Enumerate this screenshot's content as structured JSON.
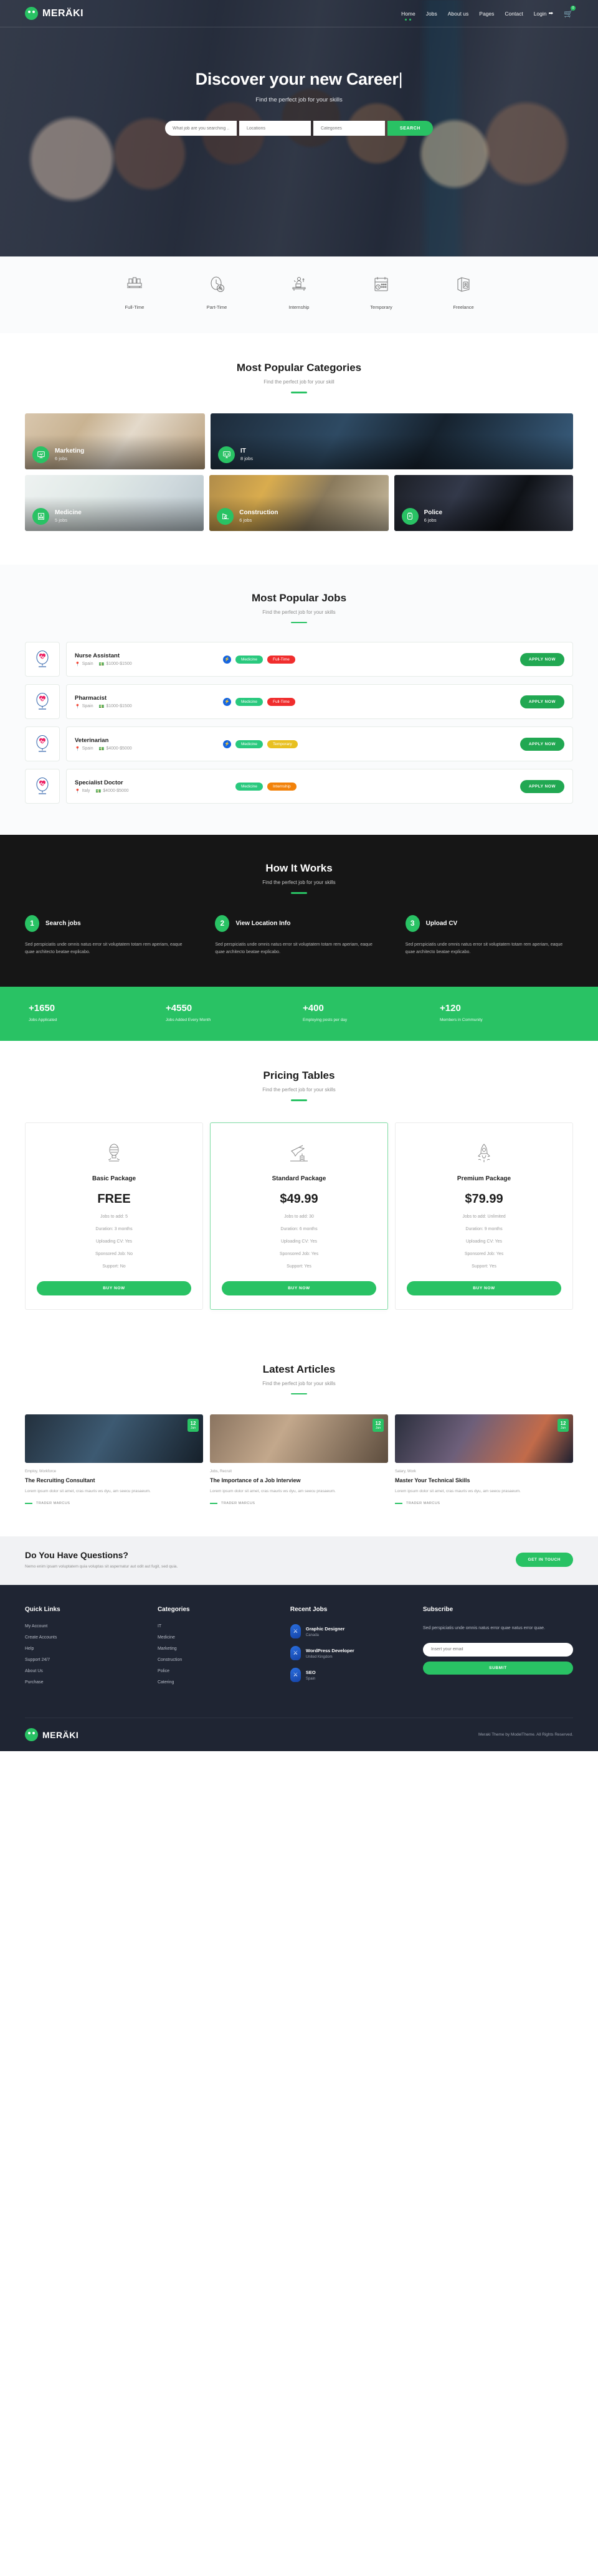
{
  "brand": {
    "name": "MERÄKI",
    "mark_icon": "smiley-dots-logo"
  },
  "nav": {
    "items": [
      {
        "label": "Home",
        "active": true
      },
      {
        "label": "Jobs",
        "active": false
      },
      {
        "label": "About us",
        "active": false
      },
      {
        "label": "Pages",
        "active": false
      },
      {
        "label": "Contact",
        "active": false
      }
    ],
    "login_label": "Login",
    "login_icon": "sign-in-icon",
    "cart_icon": "shopping-cart-icon",
    "cart_count": "0"
  },
  "hero": {
    "title": "Discover your new Career",
    "caret": "|",
    "subtitle": "Find the perfect job for your skills",
    "search": {
      "keyword_placeholder": "What job are you searching ...",
      "location_placeholder": "Locations",
      "category_placeholder": "Categories",
      "button_label": "SEARCH"
    }
  },
  "job_types": [
    {
      "label": "Full-Time",
      "icon": "reception-desk-icon"
    },
    {
      "label": "Part-Time",
      "icon": "clock-percent-icon"
    },
    {
      "label": "Internship",
      "icon": "student-desk-icon"
    },
    {
      "label": "Temporary",
      "icon": "calendar-clock-icon"
    },
    {
      "label": "Freelance",
      "icon": "portfolio-badge-icon"
    }
  ],
  "categories_section": {
    "title": "Most Popular Categories",
    "subtitle": "Find the perfect job for your skill",
    "cards": [
      {
        "name": "Marketing",
        "jobs": "6 jobs",
        "icon": "presentation-chart-icon",
        "img": "img-marketing"
      },
      {
        "name": "IT",
        "jobs": "8 jobs",
        "icon": "computer-code-icon",
        "img": "img-it"
      },
      {
        "name": "Medicine",
        "jobs": "5 jobs",
        "icon": "hospital-icon",
        "img": "img-medicine"
      },
      {
        "name": "Construction",
        "jobs": "6 jobs",
        "icon": "crane-icon",
        "img": "img-construction"
      },
      {
        "name": "Police",
        "jobs": "6 jobs",
        "icon": "police-badge-icon",
        "img": "img-police"
      }
    ]
  },
  "jobs_section": {
    "title": "Most Popular Jobs",
    "subtitle": "Find the perfect job for your skills",
    "apply_label": "APPLY NOW",
    "rows": [
      {
        "title": "Nurse Assistant",
        "location": "Spain",
        "salary": "$1000-$1500",
        "logo_icon": "heartbeat-balloon-icon",
        "bolt": true,
        "tags": [
          {
            "label": "Medicine",
            "cls": "medicine"
          },
          {
            "label": "Full-Time",
            "cls": "fulltime"
          }
        ]
      },
      {
        "title": "Pharmacist",
        "location": "Spain",
        "salary": "$1000-$1500",
        "logo_icon": "heartbeat-balloon-icon",
        "bolt": true,
        "tags": [
          {
            "label": "Medicine",
            "cls": "medicine"
          },
          {
            "label": "Full-Time",
            "cls": "fulltime"
          }
        ]
      },
      {
        "title": "Veterinarian",
        "location": "Spain",
        "salary": "$4000-$5000",
        "logo_icon": "heartbeat-balloon-icon",
        "bolt": true,
        "tags": [
          {
            "label": "Medicine",
            "cls": "medicine"
          },
          {
            "label": "Temporary",
            "cls": "temporary"
          }
        ]
      },
      {
        "title": "Specialist Doctor",
        "location": "Italy",
        "salary": "$4000-$5000",
        "logo_icon": "heartbeat-balloon-icon",
        "bolt": false,
        "tags": [
          {
            "label": "Medicine",
            "cls": "medicine"
          },
          {
            "label": "Internship",
            "cls": "internship"
          }
        ]
      }
    ]
  },
  "how_section": {
    "title": "How It Works",
    "subtitle": "Find the perfect job for your skills",
    "steps": [
      {
        "num": "1",
        "title": "Search jobs",
        "text": "Sed perspiciatis unde omnis natus error sit voluptatem totam rem aperiam, eaque quae architecto beatae explicabo."
      },
      {
        "num": "2",
        "title": "View Location Info",
        "text": "Sed perspiciatis unde omnis natus error sit voluptatem totam rem aperiam, eaque quae architecto beatae explicabo."
      },
      {
        "num": "3",
        "title": "Upload CV",
        "text": "Sed perspiciatis unde omnis natus error sit voluptatem totam rem aperiam, eaque quae architecto beatae explicabo."
      }
    ]
  },
  "stats": [
    {
      "num": "+1650",
      "label": "Jobs Applicated"
    },
    {
      "num": "+4550",
      "label": "Jobs Added Every Month"
    },
    {
      "num": "+400",
      "label": "Employing posts per day"
    },
    {
      "num": "+120",
      "label": "Members in Community"
    }
  ],
  "pricing_section": {
    "title": "Pricing Tables",
    "subtitle": "Find the perfect job for your skills",
    "buy_label": "BUY NOW",
    "plans": [
      {
        "name": "Basic Package",
        "price": "FREE",
        "icon": "lightbulb-icon",
        "featured": false,
        "features": [
          "Jobs to add: 5",
          "Duration: 3 months",
          "Uploading CV: Yes",
          "Sponsored Job: No",
          "Support: No"
        ]
      },
      {
        "name": "Standard Package",
        "price": "$49.99",
        "icon": "airplane-icon",
        "featured": true,
        "features": [
          "Jobs to add: 30",
          "Duration: 6 months",
          "Uploading CV: Yes",
          "Sponsored Job: Yes",
          "Support: Yes"
        ]
      },
      {
        "name": "Premium Package",
        "price": "$79.99",
        "icon": "rocket-icon",
        "featured": false,
        "features": [
          "Jobs to add: Unlimited",
          "Duration: 9 months",
          "Uploading CV: Yes",
          "Sponsored Job: Yes",
          "Support: Yes"
        ]
      }
    ]
  },
  "articles_section": {
    "title": "Latest Articles",
    "subtitle": "Find the perfect job for your skills",
    "cards": [
      {
        "day": "12",
        "month": "Jun",
        "category": "Employ, Workforce",
        "title": "The Recruiting Consultant",
        "text": "Lorem ipsum dolor sit amet, cras mauris ws dyu, am seecu prasaeum.",
        "author": "TRADER MARCUS",
        "thumb": "thumb-a"
      },
      {
        "day": "12",
        "month": "Jun",
        "category": "Jobs, Recruit",
        "title": "The Importance of a Job Interview",
        "text": "Lorem ipsum dolor sit amet, cras mauris ws dyu, am seecu prasaeum.",
        "author": "TRADER MARCUS",
        "thumb": "thumb-b"
      },
      {
        "day": "12",
        "month": "Jun",
        "category": "Salary, Work",
        "title": "Master Your Technical Skills",
        "text": "Lorem ipsum dolor sit amet, cras mauris ws dyu, am seecu prasaeum.",
        "author": "TRADER MARCUS",
        "thumb": "thumb-c"
      }
    ]
  },
  "questions": {
    "title": "Do You Have Questions?",
    "subtitle": "Nemo enim ipsam voluptatem quia voluptas sit aspernatur aut odit aut fugit, sed quia.",
    "button_label": "GET IN TOUCH"
  },
  "footer": {
    "quick_links": {
      "heading": "Quick Links",
      "items": [
        "My Account",
        "Create Accounts",
        "Help",
        "Support 24/7",
        "About Us",
        "Purchase"
      ]
    },
    "categories": {
      "heading": "Categories",
      "items": [
        "IT",
        "Medicine",
        "Marketing",
        "Construction",
        "Police",
        "Catering"
      ]
    },
    "recent_jobs": {
      "heading": "Recent Jobs",
      "items": [
        {
          "title": "Graphic Designer",
          "location": "Canada",
          "icon": "job-pin-icon"
        },
        {
          "title": "WordPress Developer",
          "location": "United Kingdom",
          "icon": "job-pin-icon"
        },
        {
          "title": "SEO",
          "location": "Spain",
          "icon": "job-pin-icon"
        }
      ]
    },
    "subscribe": {
      "heading": "Subscribe",
      "text": "Sed perspiciatis unde omnis natus error quae natus error quae.",
      "placeholder": "Insert your email",
      "button_label": "SUBMIT"
    },
    "copyright": "Meraki Theme by ModelTheme. All Rights Reserved."
  },
  "colors": {
    "accent": "#29c264",
    "dark": "#161616",
    "footer": "#1f2533",
    "danger": "#f02d2d",
    "warning": "#e8c020",
    "orange": "#f2820a",
    "blue": "#1565e0"
  }
}
